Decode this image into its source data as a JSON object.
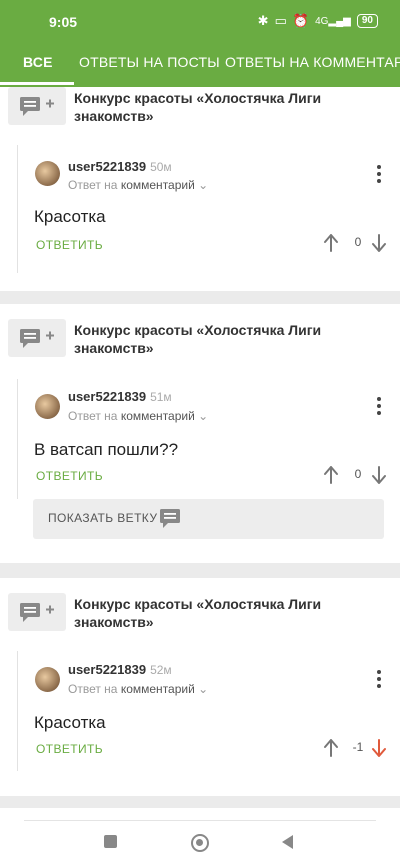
{
  "status": {
    "time": "9:05",
    "battery": "90",
    "signal_label": "4G"
  },
  "tabs": [
    {
      "label": "ВСЕ"
    },
    {
      "label": "ОТВЕТЫ НА ПОСТЫ"
    },
    {
      "label": "ОТВЕТЫ НА КОММЕНТАРИИ"
    }
  ],
  "colors": {
    "accent": "#6aac42",
    "downvote_active": "#e05a3c"
  },
  "cards": [
    {
      "post_title": "Конкурс красоты «Холостячка Лиги знакомств»",
      "comment": {
        "username": "user5221839",
        "ago": "50м",
        "reply_prefix": "Ответ на",
        "reply_target": "комментарий",
        "text": "Красотка",
        "reply_label": "ОТВЕТИТЬ",
        "score": "0",
        "vote": "none"
      }
    },
    {
      "post_title": "Конкурс красоты «Холостячка Лиги знакомств»",
      "comment": {
        "username": "user5221839",
        "ago": "51м",
        "reply_prefix": "Ответ на",
        "reply_target": "комментарий",
        "text": "В ватсап пошли??",
        "reply_label": "ОТВЕТИТЬ",
        "score": "0",
        "vote": "none"
      },
      "thread_label": "ПОКАЗАТЬ ВЕТКУ"
    },
    {
      "post_title": "Конкурс красоты «Холостячка Лиги знакомств»",
      "comment": {
        "username": "user5221839",
        "ago": "52м",
        "reply_prefix": "Ответ на",
        "reply_target": "комментарий",
        "text": "Красотка",
        "reply_label": "ОТВЕТИТЬ",
        "score": "-1",
        "vote": "down"
      }
    }
  ]
}
